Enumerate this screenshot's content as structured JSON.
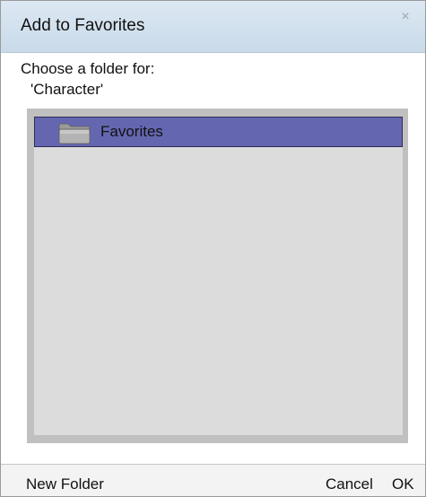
{
  "dialog": {
    "title": "Add to Favorites",
    "close_symbol": "×"
  },
  "prompt": {
    "line1": "Choose a folder for:",
    "line2": "'Character'"
  },
  "folder_tree": {
    "items": [
      {
        "label": "Favorites",
        "icon": "folder-icon",
        "selected": true
      }
    ]
  },
  "footer": {
    "new_folder_label": "New Folder",
    "cancel_label": "Cancel",
    "ok_label": "OK"
  },
  "colors": {
    "titlebar": "#c9dae9",
    "selection": "#6467b0",
    "tree_background": "#dcdcdc",
    "tree_frame": "#c0c0c0"
  }
}
